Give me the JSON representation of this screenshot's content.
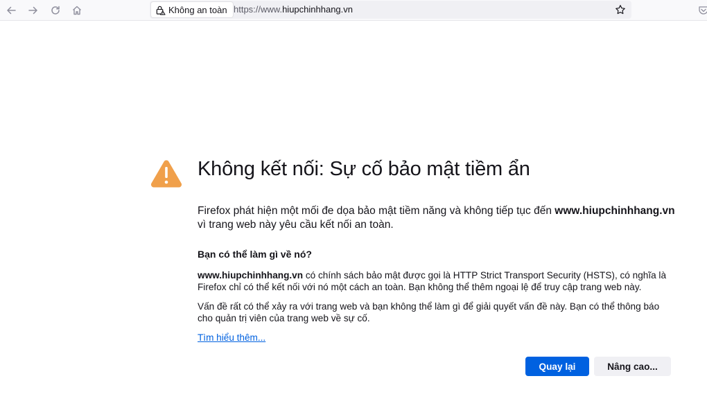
{
  "toolbar": {
    "back_icon": "back-arrow-icon",
    "forward_icon": "forward-arrow-icon",
    "reload_icon": "reload-icon",
    "home_icon": "home-icon",
    "identity_label": "Không an toàn",
    "url_scheme": "https://www.",
    "url_host": "hiupchinhhang.vn",
    "bookmark_icon": "star-icon",
    "pocket_icon": "pocket-icon"
  },
  "error": {
    "icon": "warning-icon",
    "icon_color": "#f0a04b",
    "title": "Không kết nối: Sự cố bảo mật tiềm ẩn",
    "intro_prefix": "Firefox phát hiện một mối đe dọa bảo mật tiềm năng và không tiếp tục đến ",
    "intro_host": "www.hiupchinhhang.vn",
    "intro_suffix": " vì trang web này yêu cầu kết nối an toàn.",
    "what_heading": "Bạn có thể làm gì về nó?",
    "p1_host": "www.hiupchinhhang.vn",
    "p1_text": " có chính sách bảo mật được gọi là HTTP Strict Transport Security (HSTS), có nghĩa là Firefox chỉ có thể kết nối với nó một cách an toàn. Bạn không thể thêm ngoại lệ để truy cập trang web này.",
    "p2_text": "Vấn đề rất có thể xảy ra với trang web và bạn không thể làm gì để giải quyết vấn đề này. Bạn có thể thông báo cho quản trị viên của trang web về sự cố.",
    "learn_more": "Tìm hiểu thêm...",
    "go_back_label": "Quay lại",
    "advanced_label": "Nâng cao...",
    "accent_color": "#0061e0"
  }
}
